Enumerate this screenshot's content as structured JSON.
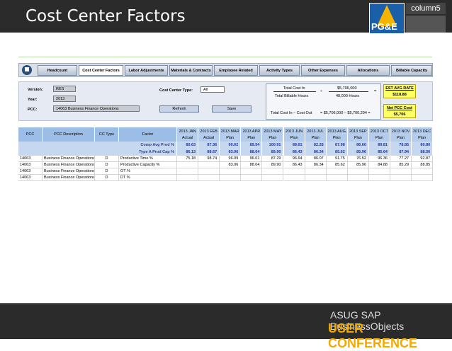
{
  "slide": {
    "title": "Cost Center Factors",
    "logo_text": "PG&E",
    "brand_text": "column5",
    "footer_line1": "ASUG SAP BusinessObjects",
    "footer_line2": "USER CONFERENCE"
  },
  "tabs": [
    {
      "label": "Headcount"
    },
    {
      "label": "Cost Center Factors",
      "active": true
    },
    {
      "label": "Labor Adjustments"
    },
    {
      "label": "Materials & Contracts"
    },
    {
      "label": "Employee Related"
    },
    {
      "label": "Activity Types"
    },
    {
      "label": "Other Expenses"
    },
    {
      "label": "Allocations"
    },
    {
      "label": "Billable Capacity"
    }
  ],
  "params": {
    "version_label": "Version:",
    "version_value": "RES",
    "year_label": "Year:",
    "year_value": "2013",
    "pcc_label": "PCC:",
    "pcc_value": "14063 Business Finance Operations",
    "cost_center_type_label": "Cost Center Type:",
    "cost_center_type_value": "All",
    "refresh_label": "Refresh",
    "save_label": "Save"
  },
  "calc": {
    "total_cost_in_label": "Total Cost In",
    "total_billable_hours_label": "Total Billable Hours",
    "total_cost_in_value": "$5,706,000",
    "total_billable_hours_value": "48,000 Hours",
    "divide": "÷",
    "equals": "=",
    "net_formula_label": "Total Cost In – Cost Out",
    "net_formula_value": "= $5,706,000 – $5,700,294 =",
    "est_avg_rate_label": "EST AVG RATE",
    "est_avg_rate_value": "$118.88",
    "net_pcc_cost_label": "Net PCC Cost",
    "net_pcc_cost_value": "$5,706"
  },
  "grid": {
    "headers": {
      "pcc": "PCC",
      "desc": "PCC Description",
      "cc_type": "CC Type",
      "factor": "Factor"
    },
    "months": [
      {
        "m": "2013 JAN",
        "t": "Actual"
      },
      {
        "m": "2013 FEB",
        "t": "Actual"
      },
      {
        "m": "2013 MAR",
        "t": "Plan"
      },
      {
        "m": "2013 APR",
        "t": "Plan"
      },
      {
        "m": "2013 MAY",
        "t": "Plan"
      },
      {
        "m": "2013 JUN",
        "t": "Plan"
      },
      {
        "m": "2013 JUL",
        "t": "Plan"
      },
      {
        "m": "2013 AUG",
        "t": "Plan"
      },
      {
        "m": "2013 SEP",
        "t": "Plan"
      },
      {
        "m": "2013 OCT",
        "t": "Plan"
      },
      {
        "m": "2013 NOV",
        "t": "Plan"
      },
      {
        "m": "2013 DEC",
        "t": "Plan"
      }
    ],
    "summary": [
      {
        "label": "Comp Avg Prod %",
        "values": [
          "80.63",
          "87.36",
          "90.62",
          "89.54",
          "100.91",
          "88.61",
          "82.28",
          "87.98",
          "86.60",
          "89.81",
          "78.85",
          "80.80"
        ]
      },
      {
        "label": "Type A Prod Cap %",
        "values": [
          "86.13",
          "88.67",
          "83.06",
          "88.04",
          "89.90",
          "86.43",
          "86.34",
          "85.62",
          "85.96",
          "85.64",
          "87.94",
          "88.56"
        ]
      }
    ],
    "rows": [
      {
        "pcc": "14063",
        "desc": "Business Finance Operations",
        "type": "D",
        "factor": "Productive Time %",
        "values": [
          "75.18",
          "98.74",
          "96.09",
          "96.01",
          "87.29",
          "96.64",
          "86.07",
          "91.75",
          "76.52",
          "96.36",
          "77.27",
          "92.87"
        ]
      },
      {
        "pcc": "14063",
        "desc": "Business Finance Operations",
        "type": "D",
        "factor": "Productive Capacity %",
        "values": [
          "",
          "",
          "83.06",
          "88.04",
          "89.90",
          "86.43",
          "86.34",
          "85.62",
          "85.96",
          "84.88",
          "85.29",
          "88.85"
        ]
      },
      {
        "pcc": "14063",
        "desc": "Business Finance Operations",
        "type": "D",
        "factor": "OT %",
        "values": [
          "",
          "",
          "",
          "",
          "",
          "",
          "",
          "",
          "",
          "",
          "",
          ""
        ]
      },
      {
        "pcc": "14063",
        "desc": "Business Finance Operations",
        "type": "D",
        "factor": "DT %",
        "values": [
          "",
          "",
          "",
          "",
          "",
          "",
          "",
          "",
          "",
          "",
          "",
          ""
        ]
      }
    ]
  }
}
